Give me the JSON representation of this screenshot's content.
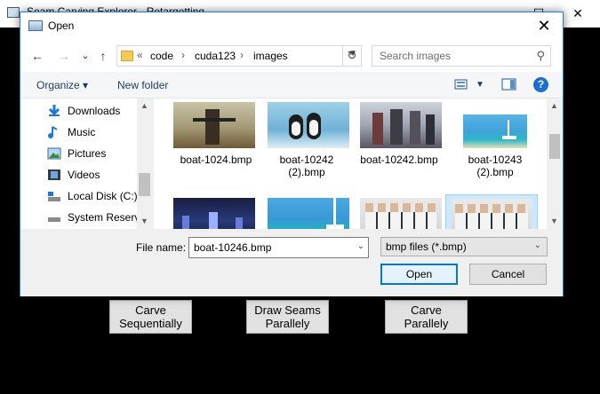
{
  "app": {
    "title": "Seam Carving Explorer - Retargetting",
    "buttons": [
      {
        "label_line1": "Carve",
        "label_line2": "Sequentially"
      },
      {
        "label_line1": "Draw Seams",
        "label_line2": "Parallely"
      },
      {
        "label_line1": "Carve",
        "label_line2": "Parallely"
      }
    ],
    "window_controls": {
      "minimize": "—",
      "maximize": "☐",
      "close": "✕"
    }
  },
  "dialog": {
    "title": "Open",
    "close_glyph": "✕",
    "nav": {
      "back": "←",
      "forward": "→",
      "recent": "⌄",
      "up": "↑"
    },
    "address": {
      "overflow": "«",
      "crumbs": [
        "code",
        "cuda123",
        "images"
      ],
      "separator": "›"
    },
    "search_placeholder": "Search images",
    "toolbar": {
      "organize": "Organize ▾",
      "new_folder": "New folder"
    },
    "nav_pane": [
      {
        "label": "Downloads",
        "icon": "download-icon"
      },
      {
        "label": "Music",
        "icon": "music-icon"
      },
      {
        "label": "Pictures",
        "icon": "pictures-icon"
      },
      {
        "label": "Videos",
        "icon": "videos-icon"
      },
      {
        "label": "Local Disk (C:)",
        "icon": "drive-icon"
      },
      {
        "label": "System Reserve",
        "icon": "drive-icon"
      }
    ],
    "files": [
      {
        "line1": "boat-1024.bmp",
        "line2": ""
      },
      {
        "line1": "boat-10242",
        "line2": "(2).bmp"
      },
      {
        "line1": "boat-10242.bmp",
        "line2": ""
      },
      {
        "line1": "boat-10243",
        "line2": "(2).bmp"
      },
      {
        "line1": "",
        "line2": ""
      },
      {
        "line1": "",
        "line2": ""
      },
      {
        "line1": "",
        "line2": ""
      },
      {
        "line1": "",
        "line2": ""
      }
    ],
    "file_name_label": "File name:",
    "file_name_value": "boat-10246.bmp",
    "file_type_value": "bmp files (*.bmp)",
    "open_label": "Open",
    "cancel_label": "Cancel",
    "colors": {
      "accent": "#0078d7",
      "selection": "#cce8ff",
      "help": "#1c6fd0"
    }
  }
}
